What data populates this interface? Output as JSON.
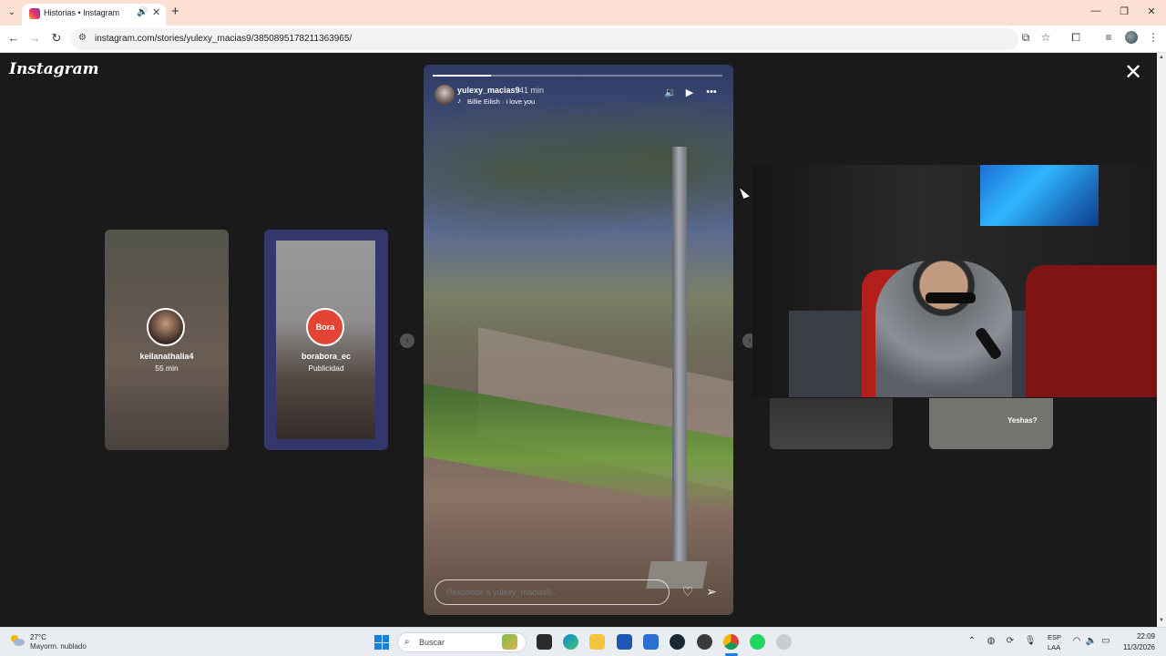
{
  "browser": {
    "tab_title": "Historias • Instagram",
    "url": "instagram.com/stories/yulexy_macias9/3850895178211363965/"
  },
  "page": {
    "logo": "Instagram"
  },
  "stories": {
    "left": [
      {
        "username": "keilanathalia4",
        "subtitle": "55 min"
      },
      {
        "username": "borabora_ec",
        "subtitle": "Publicidad",
        "avatar_text": "Bora"
      }
    ],
    "current": {
      "username": "yulexy_macias9",
      "time": "41 min",
      "music": "Billie Eilish · i love you",
      "progress": 0.2,
      "reply_placeholder": "Responde a yulexy_macias9..."
    },
    "right_overlay_text": "Yeshas?"
  },
  "taskbar": {
    "weather_temp": "27°C",
    "weather_desc": "Mayorm. nublado",
    "search_label": "Buscar",
    "lang_line1": "ESP",
    "lang_line2": "LAA",
    "time": "22:09",
    "date": "11/3/2026"
  },
  "colors": {
    "titlebar": "#fbe0d3",
    "page_bg": "#1a1a1a",
    "accent": "#1a7fe0",
    "ad_frame": "#3a3f8f"
  },
  "icons": [
    "chevron-down-icon",
    "speaker-icon",
    "close-icon",
    "plus-icon",
    "back-icon",
    "forward-icon",
    "reload-icon",
    "site-info-icon",
    "install-icon",
    "star-icon",
    "extensions-icon",
    "media-icon",
    "kebab-icon",
    "mute-icon",
    "play-icon",
    "more-icon",
    "heart-icon",
    "send-icon",
    "windows-start-icon",
    "search-icon",
    "wifi-icon",
    "volume-icon",
    "battery-icon"
  ]
}
